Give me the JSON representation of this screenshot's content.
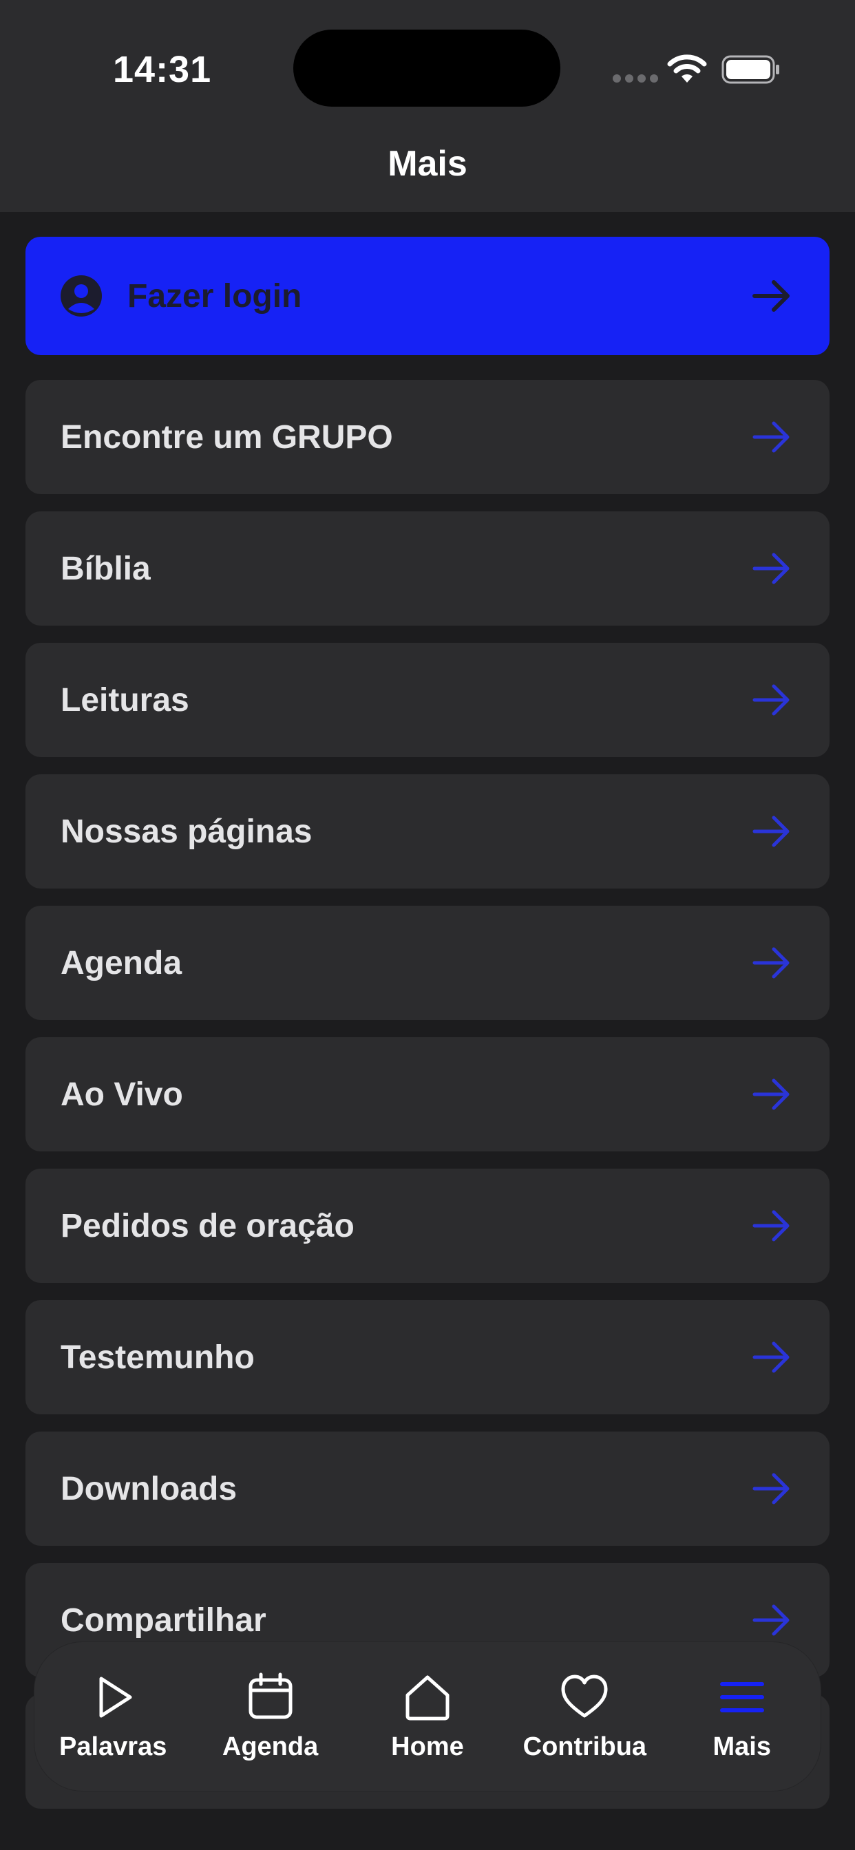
{
  "status_bar": {
    "time": "14:31",
    "icons": [
      "signal-dots-icon",
      "wifi-icon",
      "battery-icon"
    ]
  },
  "header": {
    "title": "Mais"
  },
  "colors": {
    "accent": "#1622f5",
    "arrow": "#2a34d9",
    "row_bg": "#2c2c2e",
    "background": "#1c1c1e"
  },
  "login": {
    "label": "Fazer login",
    "icon": "user-circle-icon"
  },
  "menu": {
    "items": [
      {
        "label": "Encontre um GRUPO"
      },
      {
        "label": "Bíblia"
      },
      {
        "label": "Leituras"
      },
      {
        "label": "Nossas páginas"
      },
      {
        "label": "Agenda"
      },
      {
        "label": "Ao Vivo"
      },
      {
        "label": "Pedidos de oração"
      },
      {
        "label": "Testemunho"
      },
      {
        "label": "Downloads"
      },
      {
        "label": "Compartilhar"
      }
    ]
  },
  "tabbar": {
    "items": [
      {
        "label": "Palavras",
        "icon": "play-icon"
      },
      {
        "label": "Agenda",
        "icon": "calendar-icon"
      },
      {
        "label": "Home",
        "icon": "home-icon"
      },
      {
        "label": "Contribua",
        "icon": "heart-icon"
      },
      {
        "label": "Mais",
        "icon": "menu-icon",
        "active": true
      }
    ]
  }
}
